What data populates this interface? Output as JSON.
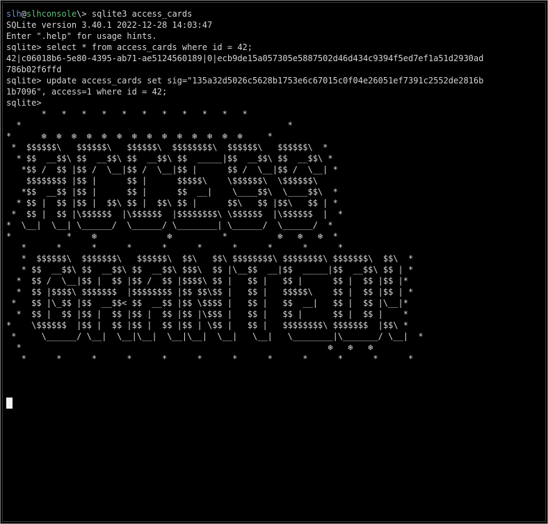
{
  "terminal": {
    "prompt_user": "slh",
    "prompt_at": "@",
    "prompt_host": "slhconsole",
    "prompt_path": "\\>",
    "initial_command": " sqlite3 access_cards",
    "lines": [
      "SQLite version 3.40.1 2022-12-28 14:03:47",
      "Enter \".help\" for usage hints.",
      "sqlite> select * from access_cards where id = 42;",
      "42|c06018b6-5e80-4395-ab71-ae5124560189|0|ecb9de15a057305e5887502d46d434c9394f5ed7ef1a51d2930ad",
      "786b02f6ffd",
      "sqlite> update access_cards set sig=\"135a32d5026c5628b1753e6c67015c0f04e26051ef7391c2552de2816b",
      "1b7096\", access=1 where id = 42;",
      "sqlite>"
    ],
    "banner": "       *   *   *   *   *   *   *   *   *   *   *\n  *                                                     *\n*      ❄  ❄  ❄  ❄  ❄  ❄  ❄  ❄  ❄  ❄  ❄  ❄  ❄  ❄     *\n *  $$$$$$\\   $$$$$$\\   $$$$$$\\  $$$$$$$$\\  $$$$$$\\   $$$$$$\\  *\n  * $$  __$$\\ $$  __$$\\ $$  __$$\\ $$  _____|$$  __$$\\ $$  __$$\\ *\n   *$$ /  $$ |$$ /  \\__|$$ /  \\__|$$ |      $$ /  \\__|$$ /  \\__| *\n    $$$$$$$$ |$$ |      $$ |      $$$$$\\    \\$$$$$$\\  \\$$$$$$\\\n   *$$  __$$ |$$ |      $$ |      $$  __|    \\____$$\\  \\____$$\\  *\n  * $$ |  $$ |$$ |  $$\\ $$ |  $$\\ $$ |      $$\\   $$ |$$\\   $$ | *\n *  $$ |  $$ |\\$$$$$$  |\\$$$$$$  |$$$$$$$$\\ \\$$$$$$  |\\$$$$$$  |  *\n*  \\__|  \\__| \\______/  \\______/ \\________| \\______/  \\______/  *\n*           *    ❄              ❄          *          ❄   ❄   ❄  *\n   *      *      *      *      *      *      *      *      *      *\n   *  $$$$$$\\  $$$$$$$\\   $$$$$$\\  $$\\   $$\\ $$$$$$$$\\ $$$$$$$$\\ $$$$$$$\\  $$\\  *\n   * $$  __$$\\ $$  __$$\\ $$  __$$\\ $$$\\  $$ |\\__$$  __|$$  _____|$$  __$$\\ $$ | *\n  *  $$ /  \\__|$$ |  $$ |$$ /  $$ |$$$$\\ $$ |   $$ |   $$ |      $$ |  $$ |$$ |*\n  *  $$ |$$$$\\ $$$$$$$  |$$$$$$$$ |$$ $$\\$$ |   $$ |   $$$$$\\    $$ |  $$ |$$ | *\n *   $$ |\\_$$ |$$  __$$< $$  __$$ |$$ \\$$$$ |   $$ |   $$  __|   $$ |  $$ |\\__|*\n  *  $$ |  $$ |$$ |  $$ |$$ |  $$ |$$ |\\$$$ |   $$ |   $$ |      $$ |  $$ |    *\n*    \\$$$$$$  |$$ |  $$ |$$ |  $$ |$$ | \\$$ |   $$ |   $$$$$$$$\\ $$$$$$$  |$$\\ *\n *     \\______/ \\__|  \\__|\\__|  \\__|\\__|  \\__|   \\__|   \\________|\\_______/ \\__|  *\n  *                                                             ❄   ❄   ❄\n   *      *      *      *      *      *      *      *      *      *      *      *"
  }
}
